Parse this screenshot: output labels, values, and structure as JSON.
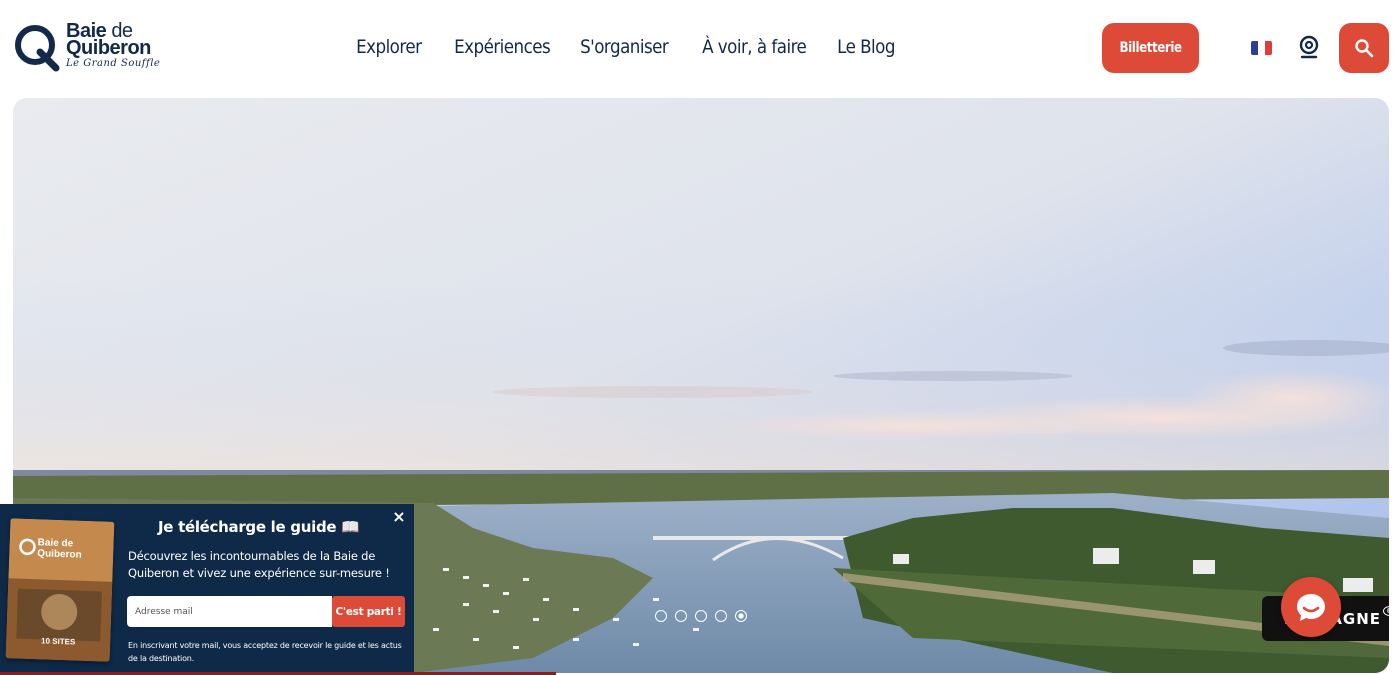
{
  "logo": {
    "line1_a": "Baie",
    "line1_b": "de",
    "line2": "Quiberon",
    "tagline": "Le Grand Souffle"
  },
  "nav": {
    "items": [
      {
        "label": "Explorer"
      },
      {
        "label": "Expériences"
      },
      {
        "label": "S'organiser"
      },
      {
        "label": "À voir, à faire"
      },
      {
        "label": "Le Blog"
      }
    ]
  },
  "header": {
    "ticket_label": "Billetterie",
    "language": "fr",
    "icons": [
      "france-flag-icon",
      "map-pin-icon",
      "search-icon"
    ]
  },
  "colors": {
    "brand_navy": "#12294a",
    "accent_red": "#dd4a37",
    "popup_bg": "#0f2a48"
  },
  "hero": {
    "slides_count": 5,
    "active_slide_index": 4,
    "partner_badge": "BRETAGNE"
  },
  "guide_popup": {
    "title": "Je télécharge le guide 📖",
    "description": "Découvrez les incontournables de la Baie de Quiberon et vivez une expérience sur-mesure !",
    "email_placeholder": "Adresse mail",
    "email_value": "",
    "submit_label": "C'est parti !",
    "legal": "En inscrivant votre mail, vous acceptez de recevoir le guide et les actus de la destination.",
    "close_label": "×",
    "cover": {
      "brand_a": "Baie de",
      "brand_b": "Quiberon",
      "count": "10 SITES"
    }
  },
  "chat": {
    "icon": "chat-bubble-icon"
  }
}
